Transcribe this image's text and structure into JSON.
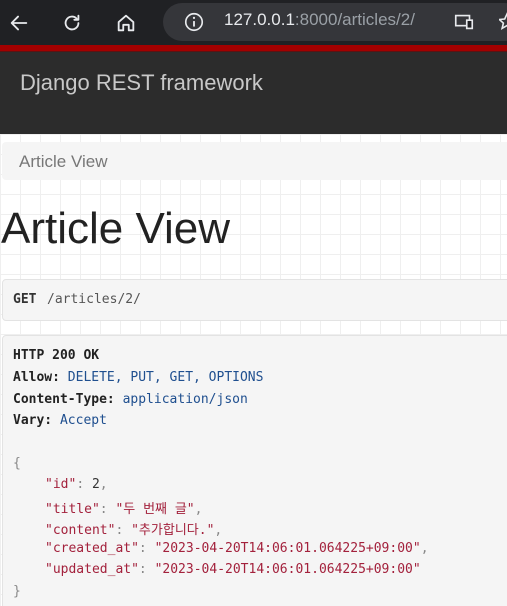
{
  "browser": {
    "url_host": "127.0.0.1",
    "url_rest": ":8000/articles/2/"
  },
  "navbar": {
    "brand": "Django REST framework"
  },
  "breadcrumb": {
    "item": "Article View"
  },
  "page": {
    "title": "Article View"
  },
  "request": {
    "method": "GET",
    "path": " /articles/2/"
  },
  "response": {
    "status": "HTTP 200 OK",
    "headers": [
      {
        "name": "Allow:",
        "value": " DELETE, PUT, GET, OPTIONS"
      },
      {
        "name": "Content-Type:",
        "value": " application/json"
      },
      {
        "name": "Vary:",
        "value": " Accept"
      }
    ],
    "open_brace": "{",
    "close_brace": "}",
    "fields": [
      {
        "key": "\"id\"",
        "sep": ": ",
        "value": "2",
        "comma": ","
      },
      {
        "key": "\"title\"",
        "sep": ": ",
        "value": "\"두 번째 글\"",
        "comma": ","
      },
      {
        "key": "\"content\"",
        "sep": ": ",
        "value": "\"추가합니다.\"",
        "comma": ","
      },
      {
        "key": "\"created_at\"",
        "sep": ": ",
        "value": "\"2023-04-20T14:06:01.064225+09:00\"",
        "comma": ","
      },
      {
        "key": "\"updated_at\"",
        "sep": ": ",
        "value": "\"2023-04-20T14:06:01.064225+09:00\"",
        "comma": ""
      }
    ]
  },
  "colors": {
    "navbar_bg": "#2c2c2c",
    "accent_red": "#a30000",
    "json_string": "#a3213c",
    "header_value": "#1f4f8f"
  },
  "icons": [
    "back-arrow-icon",
    "reload-icon",
    "home-icon",
    "info-icon",
    "cast-icon",
    "star-icon"
  ]
}
